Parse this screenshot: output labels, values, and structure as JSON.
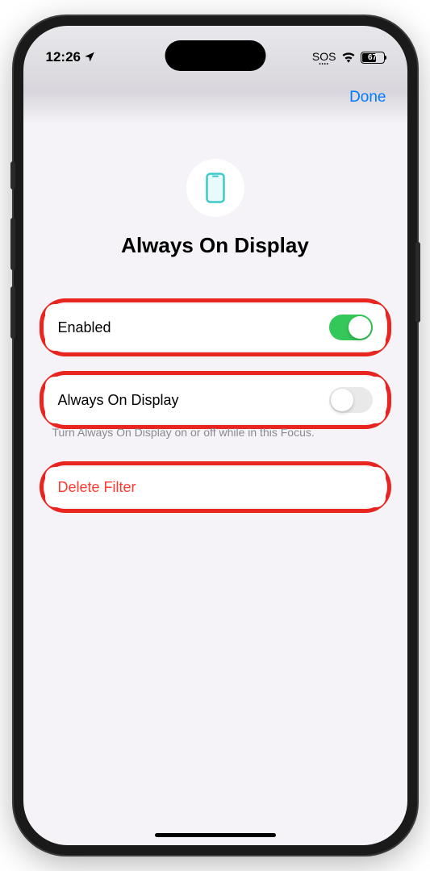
{
  "statusBar": {
    "time": "12:26",
    "sos": "SOS",
    "battery": "67"
  },
  "nav": {
    "done": "Done"
  },
  "header": {
    "title": "Always On Display"
  },
  "rows": {
    "enabled": {
      "label": "Enabled",
      "on": true
    },
    "aod": {
      "label": "Always On Display",
      "on": false
    },
    "footer": "Turn Always On Display on or off while in this Focus.",
    "delete": {
      "label": "Delete Filter"
    }
  }
}
